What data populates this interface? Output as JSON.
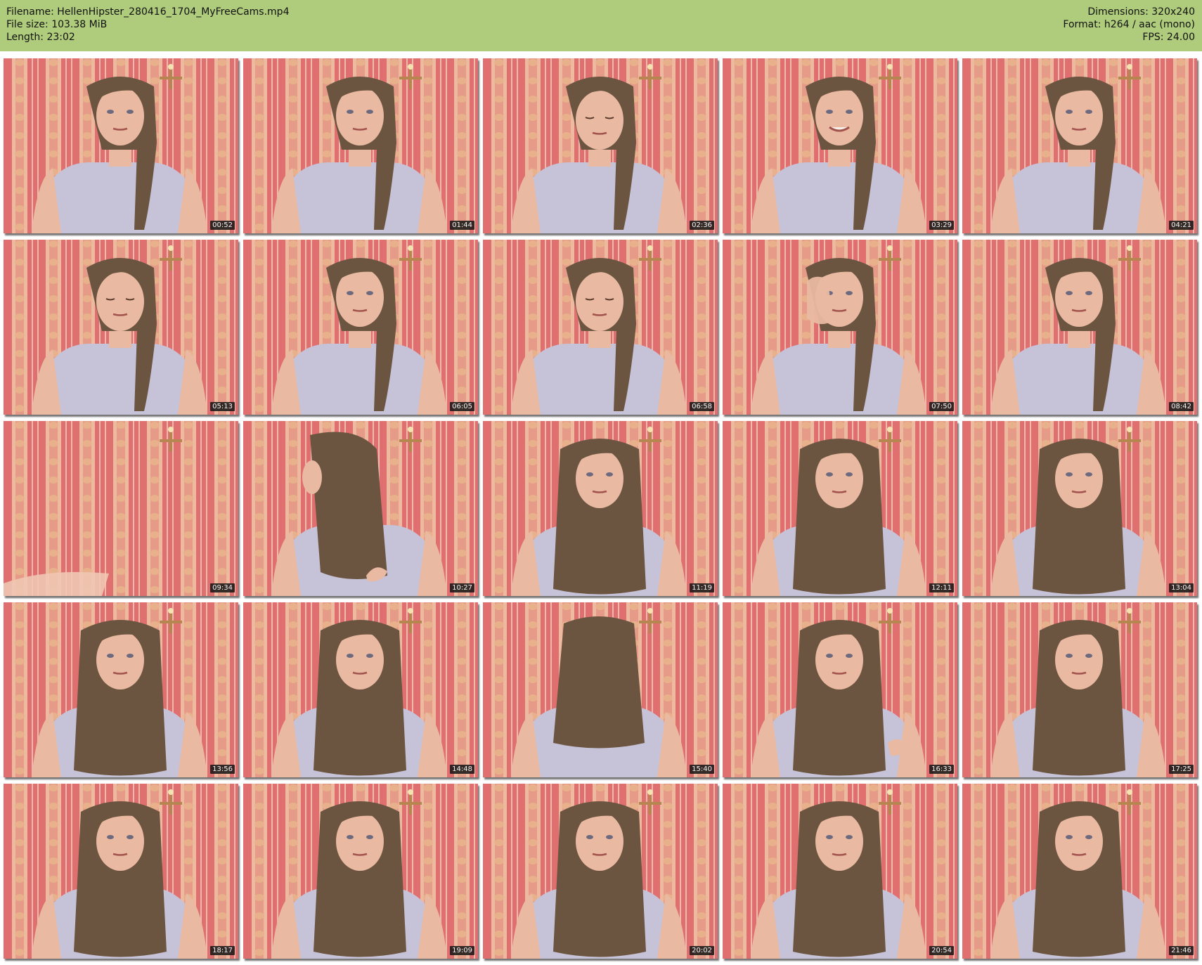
{
  "header": {
    "filename_label": "Filename: HellenHipster_280416_1704_MyFreeCams.mp4",
    "filesize_label": "File size: 103.38 MiB",
    "length_label": "Length: 23:02",
    "dimensions_label": "Dimensions: 320x240",
    "format_label": "Format: h264 / aac (mono)",
    "fps_label": "FPS: 24.00"
  },
  "colors": {
    "header_background": "#afcb7c",
    "wallpaper_red": "#e0706f",
    "wallpaper_cream": "#f1d3b0",
    "hair_brown": "#6b5440",
    "top_lavender": "#c6c3d8",
    "skin": "#e9b9a1"
  },
  "thumbnails": [
    {
      "time": "00:52",
      "pose": "front"
    },
    {
      "time": "01:44",
      "pose": "front"
    },
    {
      "time": "02:36",
      "pose": "down"
    },
    {
      "time": "03:29",
      "pose": "smile"
    },
    {
      "time": "04:21",
      "pose": "front"
    },
    {
      "time": "05:13",
      "pose": "down"
    },
    {
      "time": "06:05",
      "pose": "front"
    },
    {
      "time": "06:58",
      "pose": "down"
    },
    {
      "time": "07:50",
      "pose": "hand"
    },
    {
      "time": "08:42",
      "pose": "front"
    },
    {
      "time": "09:34",
      "pose": "empty"
    },
    {
      "time": "10:27",
      "pose": "turned"
    },
    {
      "time": "11:19",
      "pose": "loose"
    },
    {
      "time": "12:11",
      "pose": "loose"
    },
    {
      "time": "13:04",
      "pose": "loose"
    },
    {
      "time": "13:56",
      "pose": "loose"
    },
    {
      "time": "14:48",
      "pose": "loose"
    },
    {
      "time": "15:40",
      "pose": "hair-over"
    },
    {
      "time": "16:33",
      "pose": "hair-hand"
    },
    {
      "time": "17:25",
      "pose": "loose"
    },
    {
      "time": "18:17",
      "pose": "loose"
    },
    {
      "time": "19:09",
      "pose": "loose"
    },
    {
      "time": "20:02",
      "pose": "loose"
    },
    {
      "time": "20:54",
      "pose": "loose"
    },
    {
      "time": "21:46",
      "pose": "loose"
    }
  ]
}
